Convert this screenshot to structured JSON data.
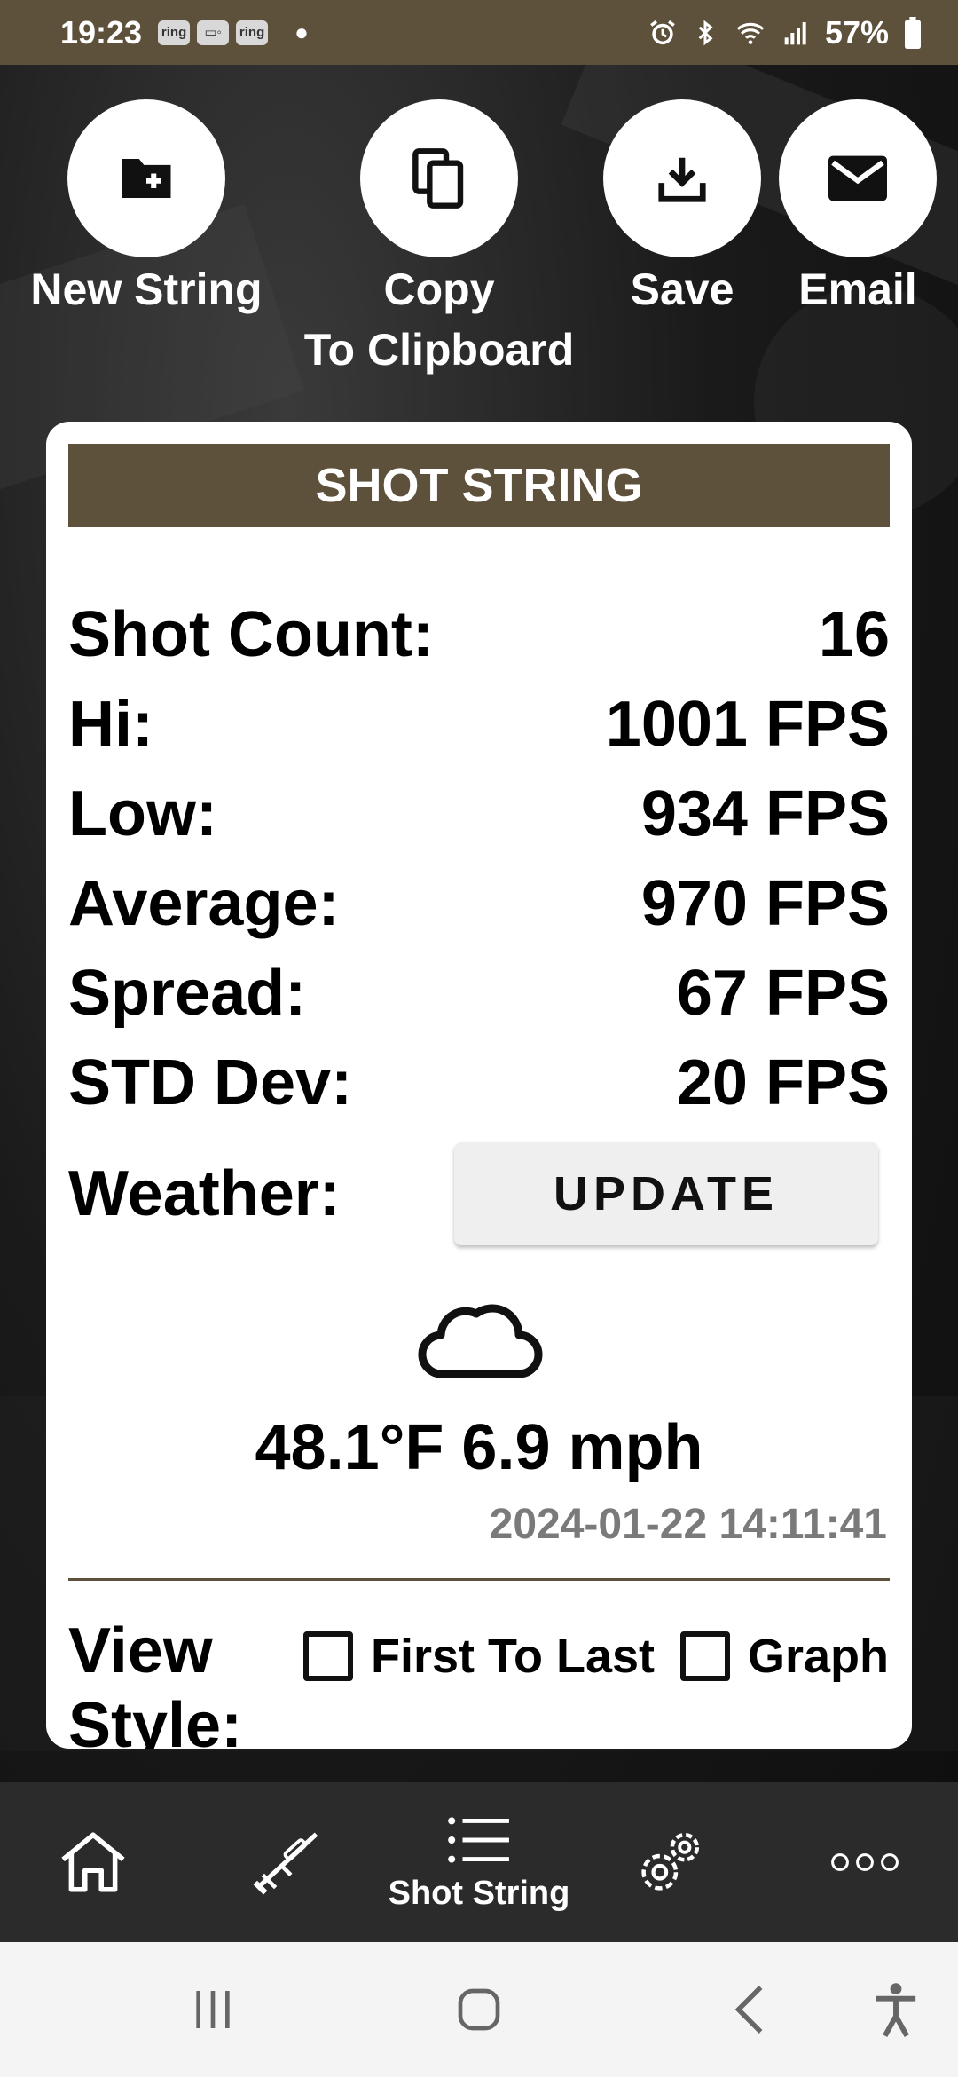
{
  "status_bar": {
    "time": "19:23",
    "badges": [
      "ring",
      "ring-cam",
      "ring"
    ],
    "battery": "57%",
    "icons": [
      "alarm-icon",
      "bluetooth-icon",
      "wifi-icon",
      "signal-icon",
      "battery-icon"
    ]
  },
  "actions": {
    "new_string": "New String",
    "copy_line1": "Copy",
    "copy_line2": "To Clipboard",
    "save": "Save",
    "email": "Email"
  },
  "card": {
    "title": "SHOT STRING",
    "stats": [
      {
        "label": "Shot Count:",
        "value": "16"
      },
      {
        "label": "Hi:",
        "value": "1001 FPS"
      },
      {
        "label": "Low:",
        "value": "934 FPS"
      },
      {
        "label": "Average:",
        "value": "970 FPS"
      },
      {
        "label": "Spread:",
        "value": "67 FPS"
      },
      {
        "label": "STD Dev:",
        "value": "20 FPS"
      }
    ],
    "weather_label": "Weather:",
    "update_button": "UPDATE",
    "weather_icon": "cloud-icon",
    "weather_value": "48.1°F 6.9 mph",
    "weather_timestamp": "2024-01-22 14:11:41",
    "view_style_label_line1": "View",
    "view_style_label_line2": "Style:",
    "view_options": [
      "First To Last",
      "Graph"
    ]
  },
  "bottom_nav": {
    "active_label": "Shot String",
    "items": [
      "home-icon",
      "rifle-icon",
      "shot-string-list-icon",
      "settings-gears-icon",
      "more-icon"
    ]
  },
  "colors": {
    "brand": "#5e513c",
    "nav_bg": "#2b2b2b"
  }
}
